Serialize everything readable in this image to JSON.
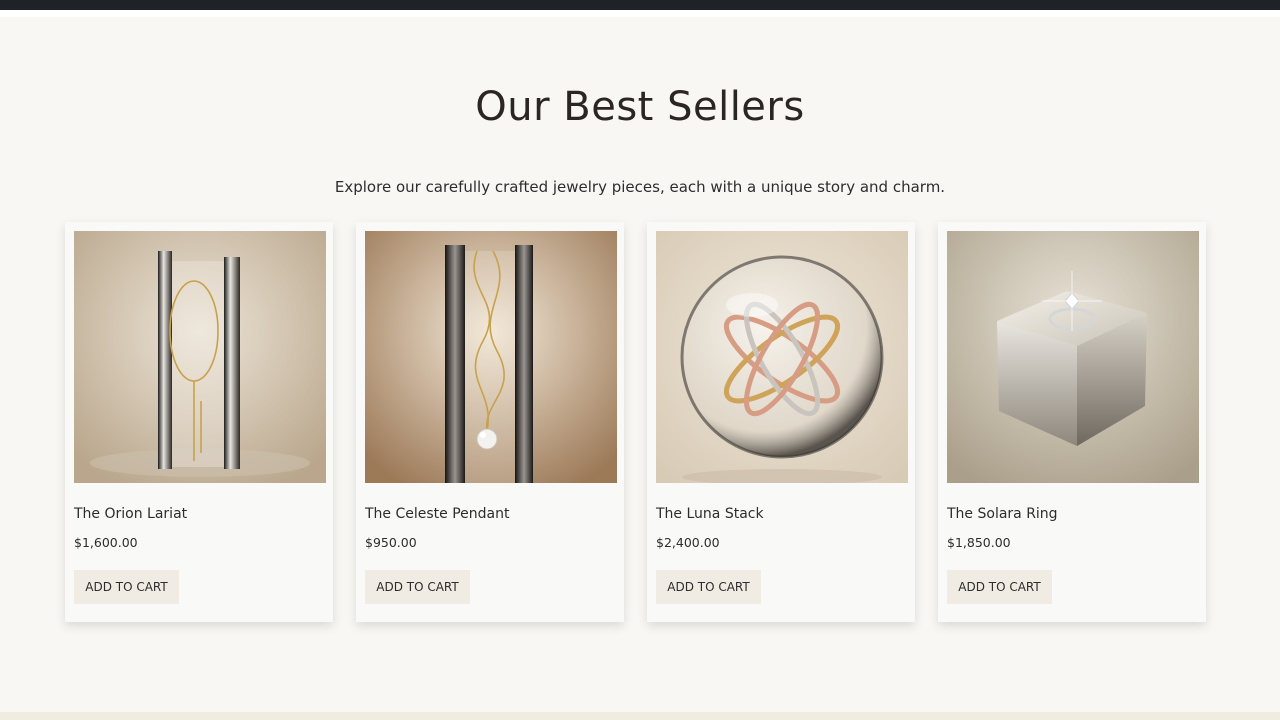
{
  "section": {
    "title": "Our Best Sellers",
    "subtitle": "Explore our carefully crafted jewelry pieces, each with a unique story and charm."
  },
  "products": [
    {
      "name": "The Orion Lariat",
      "price": "$1,600.00",
      "button": "ADD TO CART",
      "image_icon": "lariat-necklace-image"
    },
    {
      "name": "The Celeste Pendant",
      "price": "$950.00",
      "button": "ADD TO CART",
      "image_icon": "pearl-pendant-image"
    },
    {
      "name": "The Luna Stack",
      "price": "$2,400.00",
      "button": "ADD TO CART",
      "image_icon": "ring-stack-image"
    },
    {
      "name": "The Solara Ring",
      "price": "$1,850.00",
      "button": "ADD TO CART",
      "image_icon": "solitaire-ring-image"
    }
  ],
  "colors": {
    "background": "#f8f7f4",
    "topbar": "#1f2229",
    "button_bg": "#f1ece3",
    "text": "#2d2d2d"
  }
}
